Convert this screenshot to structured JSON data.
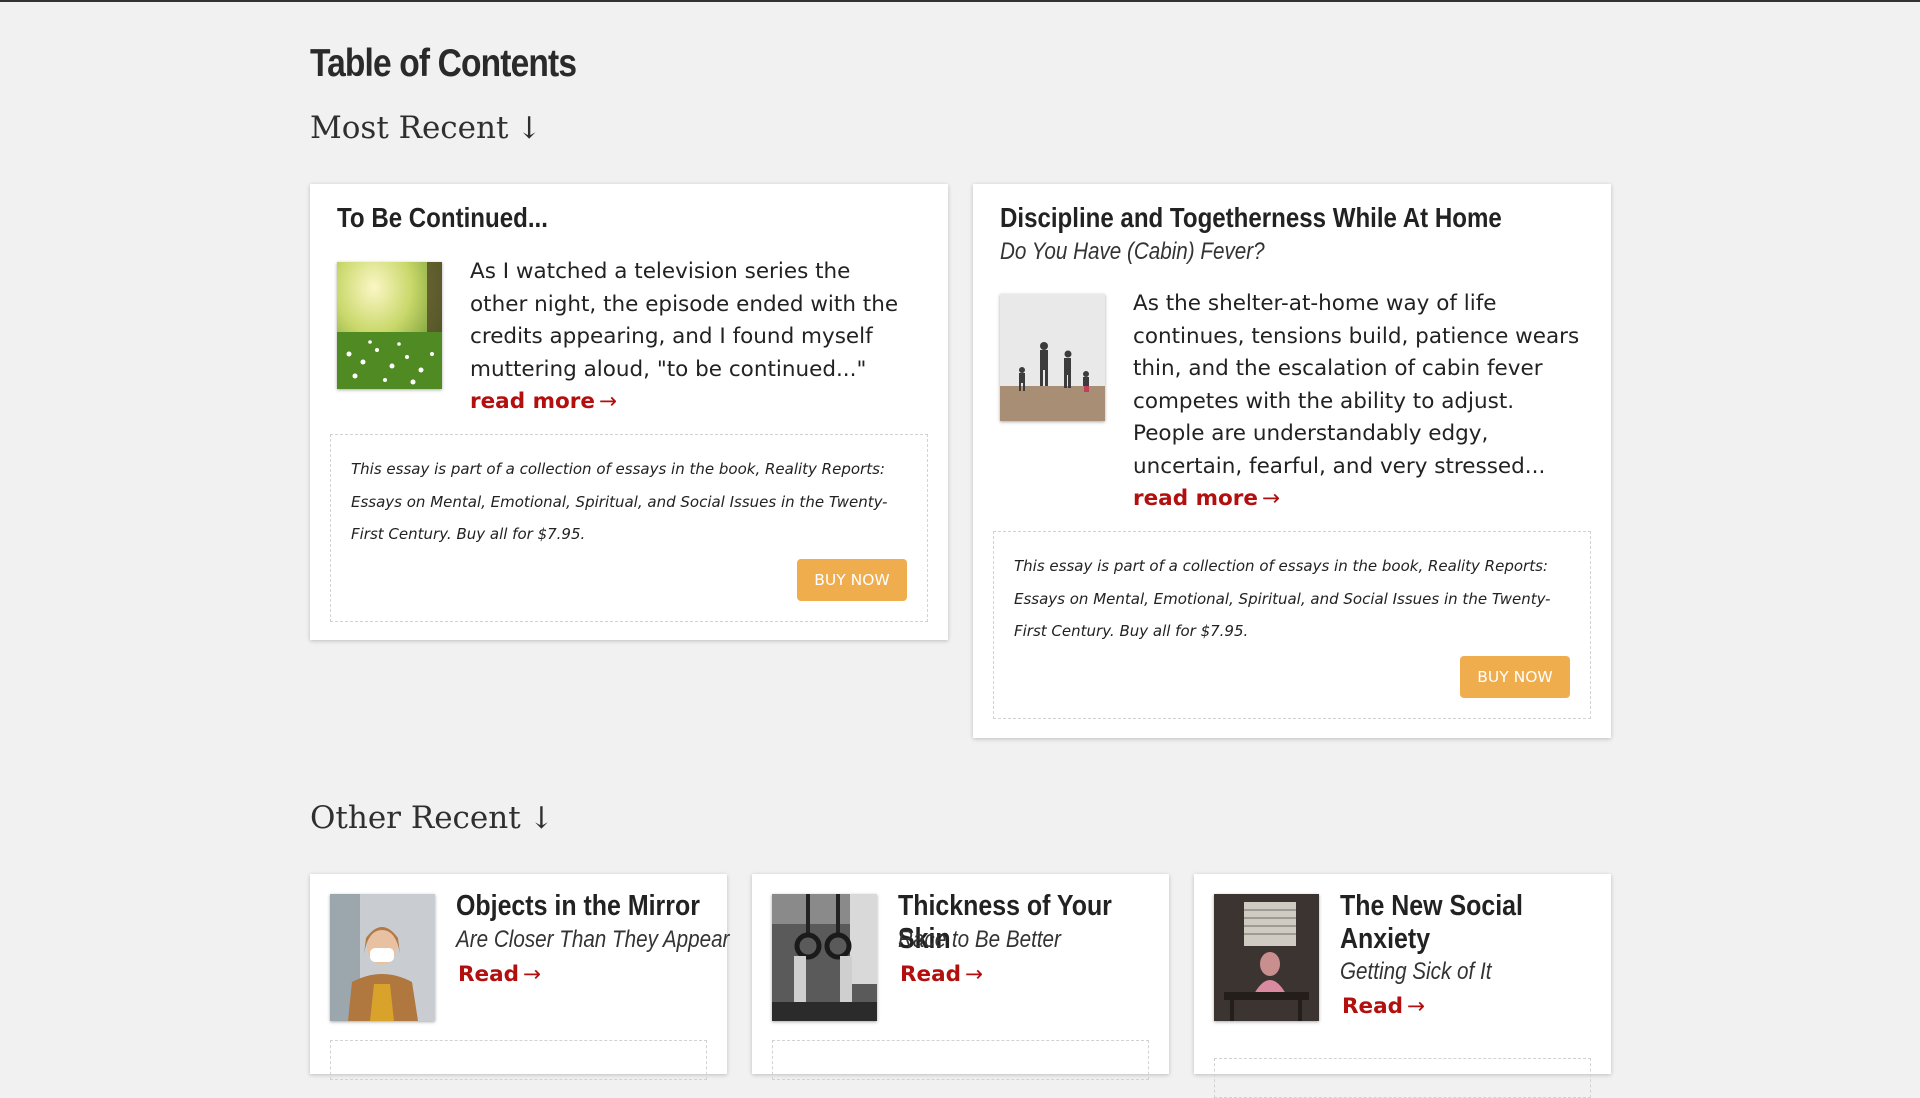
{
  "page": {
    "title": "Table of Contents"
  },
  "sections": {
    "most_recent": {
      "label": "Most Recent",
      "arrow": "↓"
    },
    "other_recent": {
      "label": "Other Recent",
      "arrow": "↓"
    }
  },
  "featured": [
    {
      "title": "To Be Continued...",
      "subtitle": "",
      "excerpt": "As I watched a television series the other night, the episode ended with the credits appearing, and I found myself muttering aloud, \"to be continued...\"",
      "read_more": "read more",
      "image": "meadow-photo",
      "promo_text": "This essay is part of a collection of essays in the book, Reality Reports: Essays on Mental, Emotional, Spiritual, and Social Issues in the Twenty-First Century. Buy all for $7.95.",
      "buy_label": "BUY NOW"
    },
    {
      "title": "Discipline and Togetherness While At Home",
      "subtitle": "Do You Have (Cabin) Fever?",
      "excerpt": "As the shelter-at-home way of life continues, tensions build, patience wears thin, and the escalation of cabin fever competes with the ability to adjust. People are understandably edgy, uncertain, fearful, and very stressed...",
      "read_more": "read more",
      "image": "family-walking-photo",
      "promo_text": "This essay is part of a collection of essays in the book, Reality Reports: Essays on Mental, Emotional, Spiritual, and Social Issues in the Twenty-First Century. Buy all for $7.95.",
      "buy_label": "BUY NOW"
    }
  ],
  "other": [
    {
      "title": "Objects in the Mirror",
      "subtitle": "Are Closer Than They Appear",
      "read_label": "Read",
      "image": "woman-mask-photo"
    },
    {
      "title": "Thickness of Your Skin",
      "subtitle": "Race to Be Better",
      "read_label": "Read",
      "image": "gym-rings-photo"
    },
    {
      "title": "The New Social Anxiety",
      "subtitle": "Getting Sick of It",
      "read_label": "Read",
      "image": "girl-at-table-photo"
    }
  ],
  "colors": {
    "background": "#f1f1f1",
    "link_red": "#b30f0f",
    "button_orange": "#f0ad4e"
  },
  "icons": {
    "section_arrow": "arrow-down-icon",
    "link_arrow": "arrow-right-icon"
  }
}
